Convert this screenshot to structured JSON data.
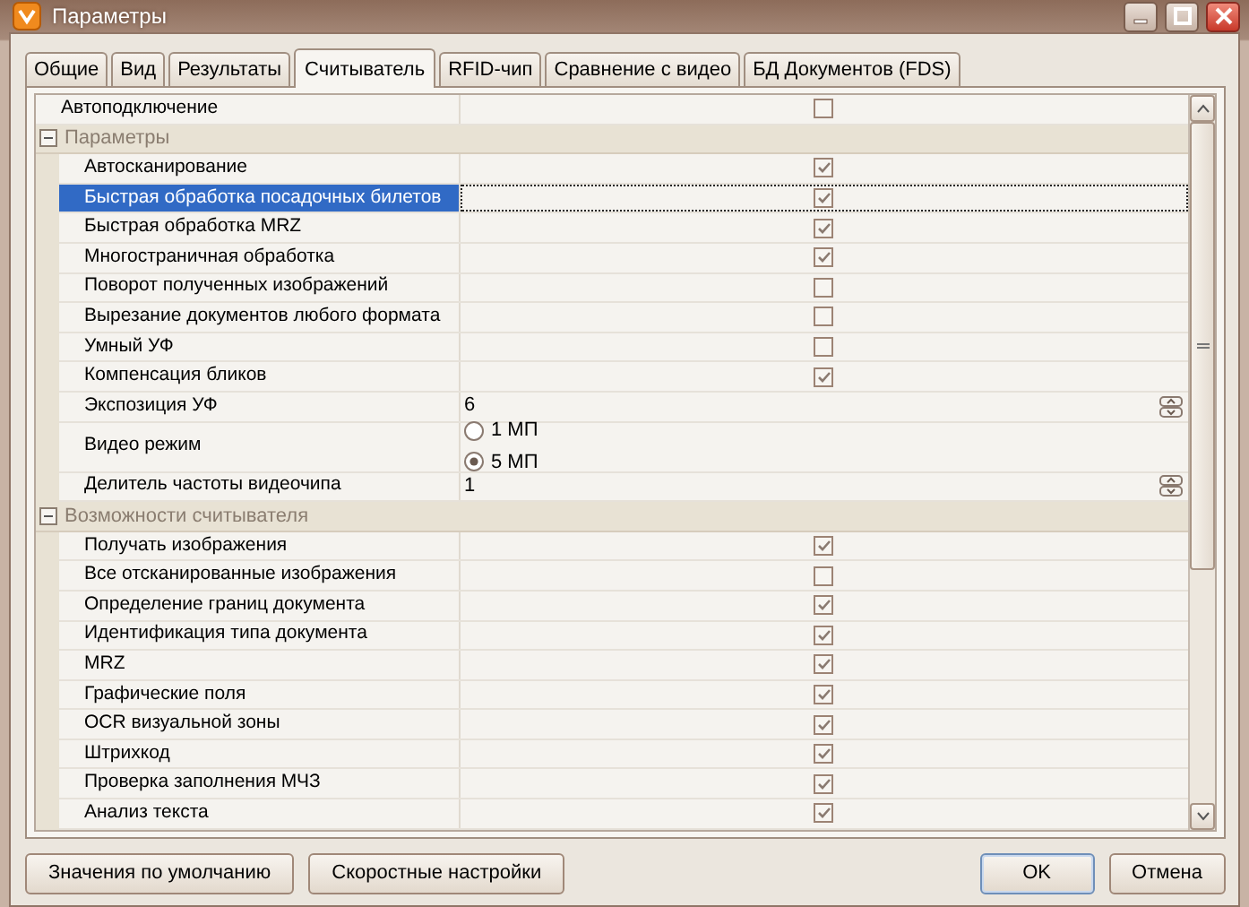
{
  "window": {
    "title": "Параметры"
  },
  "tabs": [
    {
      "label": "Общие",
      "selected": false
    },
    {
      "label": "Вид",
      "selected": false
    },
    {
      "label": "Результаты",
      "selected": false
    },
    {
      "label": "Считыватель",
      "selected": true
    },
    {
      "label": "RFID-чип",
      "selected": false
    },
    {
      "label": "Сравнение с видео",
      "selected": false
    },
    {
      "label": "БД Документов (FDS)",
      "selected": false
    }
  ],
  "properties": [
    {
      "kind": "checkbox",
      "label": "Автоподключение",
      "checked": false,
      "selected": false
    },
    {
      "kind": "group",
      "label": "Параметры",
      "expanded": true,
      "children": [
        {
          "kind": "checkbox",
          "label": "Автосканирование",
          "checked": true,
          "selected": false
        },
        {
          "kind": "checkbox",
          "label": "Быстрая обработка посадочных билетов",
          "checked": true,
          "selected": true
        },
        {
          "kind": "checkbox",
          "label": "Быстрая обработка MRZ",
          "checked": true,
          "selected": false
        },
        {
          "kind": "checkbox",
          "label": "Многостраничная обработка",
          "checked": true,
          "selected": false
        },
        {
          "kind": "checkbox",
          "label": "Поворот полученных изображений",
          "checked": false,
          "selected": false
        },
        {
          "kind": "checkbox",
          "label": "Вырезание документов любого формата",
          "checked": false,
          "selected": false
        },
        {
          "kind": "checkbox",
          "label": "Умный УФ",
          "checked": false,
          "selected": false
        },
        {
          "kind": "checkbox",
          "label": "Компенсация бликов",
          "checked": true,
          "selected": false
        },
        {
          "kind": "spin",
          "label": "Экспозиция УФ",
          "value": "6",
          "selected": false
        },
        {
          "kind": "radio",
          "label": "Видео режим",
          "selected": false,
          "options": [
            {
              "label": "1 МП",
              "selected": false
            },
            {
              "label": "5 МП",
              "selected": true
            }
          ]
        },
        {
          "kind": "spin",
          "label": "Делитель частоты видеочипа",
          "value": "1",
          "selected": false
        }
      ]
    },
    {
      "kind": "group",
      "label": "Возможности считывателя",
      "expanded": true,
      "children": [
        {
          "kind": "checkbox",
          "label": "Получать изображения",
          "checked": true,
          "selected": false
        },
        {
          "kind": "checkbox",
          "label": "Все отсканированные изображения",
          "checked": false,
          "selected": false
        },
        {
          "kind": "checkbox",
          "label": "Определение границ документа",
          "checked": true,
          "selected": false
        },
        {
          "kind": "checkbox",
          "label": "Идентификация типа документа",
          "checked": true,
          "selected": false
        },
        {
          "kind": "checkbox",
          "label": "MRZ",
          "checked": true,
          "selected": false
        },
        {
          "kind": "checkbox",
          "label": "Графические поля",
          "checked": true,
          "selected": false
        },
        {
          "kind": "checkbox",
          "label": "OCR визуальной зоны",
          "checked": true,
          "selected": false
        },
        {
          "kind": "checkbox",
          "label": "Штрихкод",
          "checked": true,
          "selected": false
        },
        {
          "kind": "checkbox",
          "label": "Проверка заполнения МЧЗ",
          "checked": true,
          "selected": false
        },
        {
          "kind": "checkbox",
          "label": "Анализ текста",
          "checked": true,
          "selected": false
        }
      ]
    }
  ],
  "left_buttons": [
    {
      "label": "Значения по умолчанию",
      "default": false
    },
    {
      "label": "Скоростные настройки",
      "default": false
    }
  ],
  "right_buttons": [
    {
      "label": "OK",
      "default": true
    },
    {
      "label": "Отмена",
      "default": false
    }
  ]
}
